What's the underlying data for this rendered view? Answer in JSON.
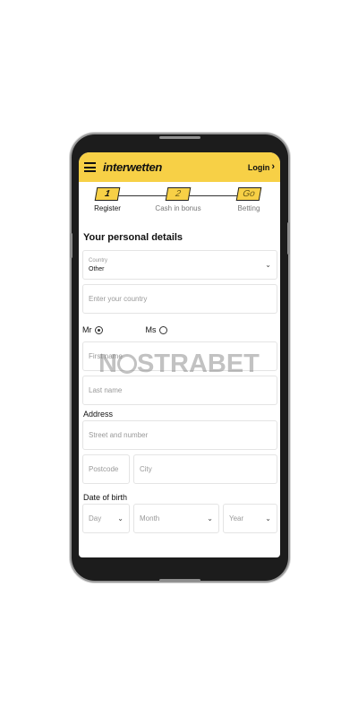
{
  "header": {
    "logo": "interwetten",
    "login": "Login"
  },
  "steps": [
    {
      "badge": "1",
      "label": "Register"
    },
    {
      "badge": "2",
      "label": "Cash in bonus"
    },
    {
      "badge": "Go",
      "label": "Betting"
    }
  ],
  "form": {
    "section_title": "Your personal details",
    "country": {
      "label": "Country",
      "value": "Other"
    },
    "country_input": {
      "placeholder": "Enter your country"
    },
    "gender": {
      "mr": "Mr",
      "ms": "Ms",
      "selected": "Mr"
    },
    "first_name": {
      "placeholder": "First name"
    },
    "last_name": {
      "placeholder": "Last name"
    },
    "address_label": "Address",
    "street": {
      "placeholder": "Street and number"
    },
    "postcode": {
      "placeholder": "Postcode"
    },
    "city": {
      "placeholder": "City"
    },
    "dob_label": "Date of birth",
    "dob": {
      "day": "Day",
      "month": "Month",
      "year": "Year"
    }
  },
  "watermark": {
    "text_a": "N",
    "text_b": "STRABET"
  },
  "colors": {
    "brand_yellow": "#f7d046",
    "text": "#111111",
    "placeholder": "#999999"
  }
}
